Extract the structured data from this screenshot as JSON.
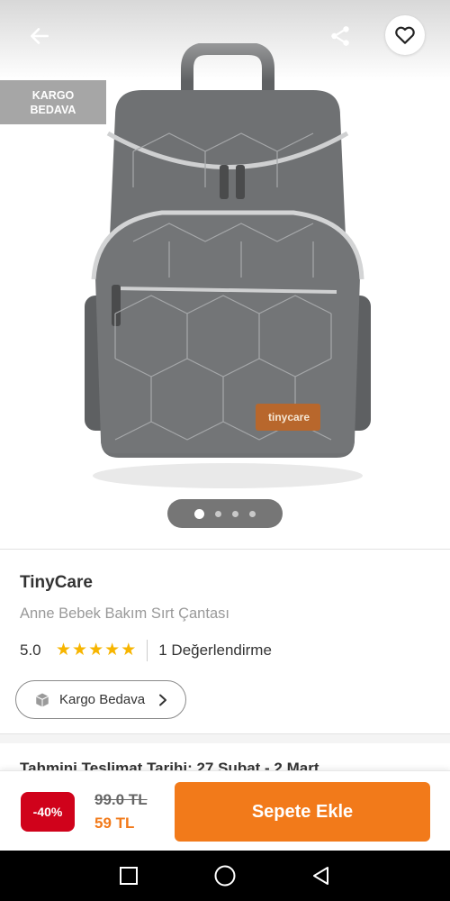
{
  "header": {
    "back_icon": "arrow-left-icon",
    "share_icon": "share-icon",
    "favorite_icon": "heart-icon"
  },
  "badge": {
    "line1": "KARGO",
    "line2": "BEDAVA"
  },
  "product_image": {
    "logo_text": "tinycare",
    "carousel_total": 4,
    "carousel_active_index": 0
  },
  "product": {
    "brand": "TinyCare",
    "name": "Anne Bebek Bakım Sırt Çantası",
    "rating": "5.0",
    "stars": 5,
    "reviews": "1 Değerlendirme"
  },
  "shipping": {
    "label": "Kargo Bedava",
    "icon": "package-icon",
    "delivery_text": "Tahmini Teslimat Tarihi: 27 Şubat - 2 Mart"
  },
  "purchase": {
    "discount": "-40%",
    "old_price": "99.0 TL",
    "new_price": "59 TL",
    "cart_button": "Sepete Ekle"
  },
  "colors": {
    "accent": "#f27a1a",
    "discount": "#d0021b",
    "star": "#f7b500"
  }
}
